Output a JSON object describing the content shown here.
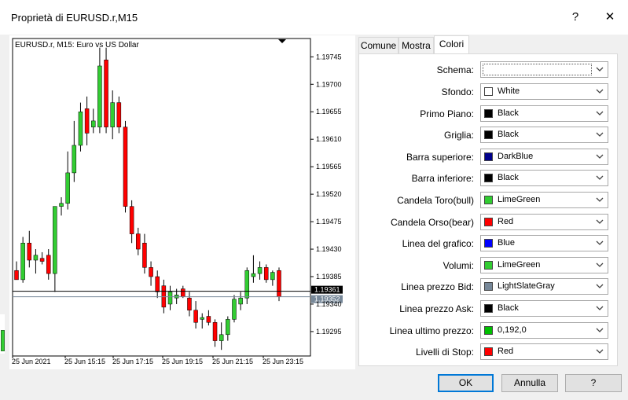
{
  "window": {
    "title": "Proprietà di EURUSD.r,M15",
    "help_label": "?",
    "close_label": "✕"
  },
  "chart": {
    "header": "EURUSD.r, M15:  Euro vs US Dollar",
    "bid_label": "1.19361",
    "ask_label": "1.19352",
    "bid_color": "#778899",
    "ask_color": "#000000"
  },
  "chart_data": {
    "type": "candlestick",
    "y_ticks": [
      "1.19745",
      "1.19700",
      "1.19655",
      "1.19610",
      "1.19565",
      "1.19520",
      "1.19475",
      "1.19430",
      "1.19385",
      "1.19340",
      "1.19295"
    ],
    "x_ticks": [
      "25 Jun 2021",
      "25 Jun 15:15",
      "25 Jun 17:15",
      "25 Jun 19:15",
      "25 Jun 21:15",
      "25 Jun 23:15"
    ],
    "ylim": [
      1.19255,
      1.19775
    ],
    "bid": 1.19361,
    "ask": 1.19352,
    "bull_color": "#32CD32",
    "bear_color": "#FF0000",
    "candles": [
      {
        "o": 1.19395,
        "h": 1.1941,
        "l": 1.1938,
        "c": 1.1938
      },
      {
        "o": 1.1938,
        "h": 1.1945,
        "l": 1.19375,
        "c": 1.1944
      },
      {
        "o": 1.1944,
        "h": 1.1946,
        "l": 1.194,
        "c": 1.19412
      },
      {
        "o": 1.19412,
        "h": 1.1943,
        "l": 1.1939,
        "c": 1.1942
      },
      {
        "o": 1.19415,
        "h": 1.19425,
        "l": 1.19405,
        "c": 1.1941
      },
      {
        "o": 1.1942,
        "h": 1.1943,
        "l": 1.1938,
        "c": 1.1939
      },
      {
        "o": 1.1939,
        "h": 1.195,
        "l": 1.1936,
        "c": 1.195
      },
      {
        "o": 1.195,
        "h": 1.19515,
        "l": 1.19485,
        "c": 1.19505
      },
      {
        "o": 1.19505,
        "h": 1.1959,
        "l": 1.19495,
        "c": 1.19555
      },
      {
        "o": 1.19555,
        "h": 1.1964,
        "l": 1.1954,
        "c": 1.196
      },
      {
        "o": 1.196,
        "h": 1.1967,
        "l": 1.1959,
        "c": 1.19655
      },
      {
        "o": 1.1966,
        "h": 1.1968,
        "l": 1.196,
        "c": 1.1962
      },
      {
        "o": 1.1963,
        "h": 1.1966,
        "l": 1.1962,
        "c": 1.1964
      },
      {
        "o": 1.1963,
        "h": 1.1976,
        "l": 1.1962,
        "c": 1.1973
      },
      {
        "o": 1.1974,
        "h": 1.1976,
        "l": 1.1962,
        "c": 1.1963
      },
      {
        "o": 1.1963,
        "h": 1.1969,
        "l": 1.1961,
        "c": 1.1967
      },
      {
        "o": 1.1967,
        "h": 1.1968,
        "l": 1.1962,
        "c": 1.1963
      },
      {
        "o": 1.1963,
        "h": 1.1964,
        "l": 1.1949,
        "c": 1.195
      },
      {
        "o": 1.195,
        "h": 1.1951,
        "l": 1.1944,
        "c": 1.19455
      },
      {
        "o": 1.19455,
        "h": 1.19465,
        "l": 1.1942,
        "c": 1.1943
      },
      {
        "o": 1.1944,
        "h": 1.19455,
        "l": 1.1939,
        "c": 1.194
      },
      {
        "o": 1.194,
        "h": 1.1941,
        "l": 1.1937,
        "c": 1.19385
      },
      {
        "o": 1.19385,
        "h": 1.19395,
        "l": 1.1935,
        "c": 1.1936
      },
      {
        "o": 1.1937,
        "h": 1.1938,
        "l": 1.19325,
        "c": 1.19335
      },
      {
        "o": 1.1934,
        "h": 1.1937,
        "l": 1.1933,
        "c": 1.1936
      },
      {
        "o": 1.1935,
        "h": 1.19365,
        "l": 1.1934,
        "c": 1.19355
      },
      {
        "o": 1.19365,
        "h": 1.1937,
        "l": 1.1935,
        "c": 1.19352
      },
      {
        "o": 1.1935,
        "h": 1.1936,
        "l": 1.1932,
        "c": 1.1933
      },
      {
        "o": 1.1933,
        "h": 1.19345,
        "l": 1.193,
        "c": 1.1931
      },
      {
        "o": 1.19315,
        "h": 1.19325,
        "l": 1.193,
        "c": 1.19318
      },
      {
        "o": 1.1932,
        "h": 1.1933,
        "l": 1.19305,
        "c": 1.1931
      },
      {
        "o": 1.1931,
        "h": 1.19315,
        "l": 1.1927,
        "c": 1.1928
      },
      {
        "o": 1.1928,
        "h": 1.1931,
        "l": 1.19265,
        "c": 1.1929
      },
      {
        "o": 1.1929,
        "h": 1.1932,
        "l": 1.1928,
        "c": 1.19315
      },
      {
        "o": 1.19315,
        "h": 1.19355,
        "l": 1.1931,
        "c": 1.19348
      },
      {
        "o": 1.1934,
        "h": 1.1936,
        "l": 1.1933,
        "c": 1.1935
      },
      {
        "o": 1.1935,
        "h": 1.194,
        "l": 1.1934,
        "c": 1.19395
      },
      {
        "o": 1.19385,
        "h": 1.1942,
        "l": 1.19375,
        "c": 1.1939
      },
      {
        "o": 1.1939,
        "h": 1.1941,
        "l": 1.1938,
        "c": 1.194
      },
      {
        "o": 1.194,
        "h": 1.19405,
        "l": 1.19375,
        "c": 1.1938
      },
      {
        "o": 1.1938,
        "h": 1.19395,
        "l": 1.1937,
        "c": 1.19392
      },
      {
        "o": 1.19395,
        "h": 1.194,
        "l": 1.19345,
        "c": 1.19352
      }
    ]
  },
  "tabs": [
    {
      "label": "Comune"
    },
    {
      "label": "Mostra"
    },
    {
      "label": "Colori"
    }
  ],
  "colors": {
    "schema": {
      "label": "Schema:",
      "value": ""
    },
    "rows": [
      {
        "label": "Sfondo:",
        "value": "White",
        "swatch": "#FFFFFF"
      },
      {
        "label": "Primo Piano:",
        "value": "Black",
        "swatch": "#000000"
      },
      {
        "label": "Griglia:",
        "value": "Black",
        "swatch": "#000000"
      },
      {
        "label": "Barra superiore:",
        "value": "DarkBlue",
        "swatch": "#00008B"
      },
      {
        "label": "Barra inferiore:",
        "value": "Black",
        "swatch": "#000000"
      },
      {
        "label": "Candela Toro(bull)",
        "value": "LimeGreen",
        "swatch": "#32CD32"
      },
      {
        "label": "Candela Orso(bear)",
        "value": "Red",
        "swatch": "#FF0000"
      },
      {
        "label": "Linea del grafico:",
        "value": "Blue",
        "swatch": "#0000FF"
      },
      {
        "label": "Volumi:",
        "value": "LimeGreen",
        "swatch": "#32CD32"
      },
      {
        "label": "Linea prezzo Bid:",
        "value": "LightSlateGray",
        "swatch": "#778899"
      },
      {
        "label": "Linea prezzo Ask:",
        "value": "Black",
        "swatch": "#000000"
      },
      {
        "label": "Linea ultimo prezzo:",
        "value": "0,192,0",
        "swatch": "#00C000"
      },
      {
        "label": "Livelli di Stop:",
        "value": "Red",
        "swatch": "#FF0000"
      }
    ]
  },
  "buttons": {
    "ok": "OK",
    "cancel": "Annulla",
    "help": "?"
  }
}
